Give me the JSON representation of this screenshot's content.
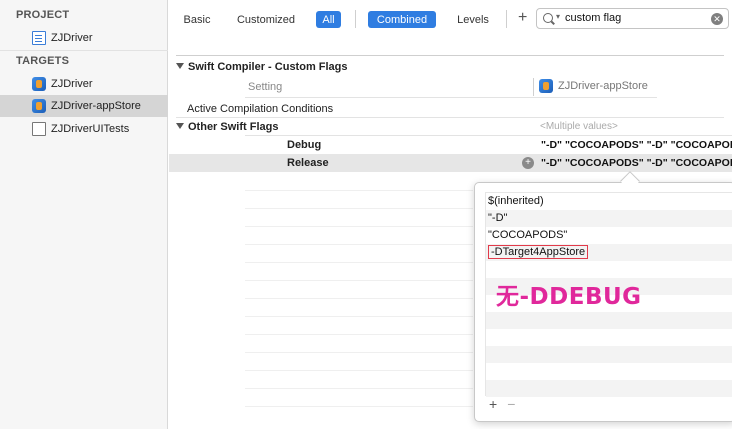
{
  "sidebar": {
    "project_header": "PROJECT",
    "project_item": "ZJDriver",
    "targets_header": "TARGETS",
    "targets": [
      {
        "label": "ZJDriver",
        "icon": "app-icon"
      },
      {
        "label": "ZJDriver-appStore",
        "icon": "app-icon",
        "selected": true
      },
      {
        "label": "ZJDriverUITests",
        "icon": "folder-icon"
      }
    ]
  },
  "toolbar": {
    "tabs": [
      "Basic",
      "Customized",
      "All"
    ],
    "view_modes": [
      "Combined",
      "Levels"
    ],
    "active_tab": "All",
    "active_view": "Combined",
    "add_label": "+",
    "search_value": "custom flag",
    "accent": "#2f7de1"
  },
  "settings": {
    "section_title": "Swift Compiler - Custom Flags",
    "column_setting": "Setting",
    "column_target": "ZJDriver-appStore",
    "active_compilation_conditions": "Active Compilation Conditions",
    "other_swift_flags": "Other Swift Flags",
    "multiple_values": "<Multiple values>",
    "debug_label": "Debug",
    "debug_value": "\"-D\" \"COCOAPODS\" \"-D\" \"COCOAPODS\"",
    "release_label": "Release",
    "release_value": "\"-D\" \"COCOAPODS\" \"-D\" \"COCOAPODS\""
  },
  "popover": {
    "items": [
      "$(inherited)",
      "\"-D\"",
      "\"COCOAPODS\"",
      "-DTarget4AppStore"
    ],
    "editing_index": 3,
    "add_label": "+",
    "remove_label": "−"
  },
  "annotation": {
    "text": "无-DDEBUG",
    "color": "#e0289b"
  }
}
